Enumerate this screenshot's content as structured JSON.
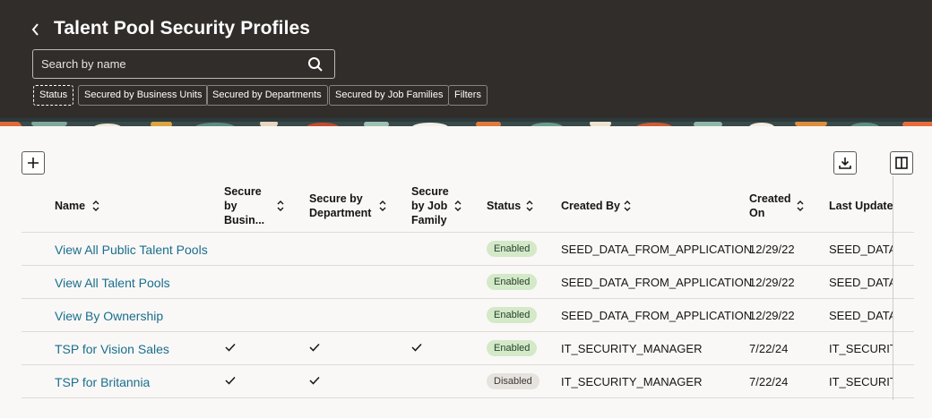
{
  "header": {
    "title": "Talent Pool Security Profiles",
    "search_placeholder": "Search by name",
    "filter_chips": [
      {
        "label": "Status"
      },
      {
        "label": "Secured by Business Units"
      },
      {
        "label": "Secured by Departments"
      },
      {
        "label": "Secured by Job Families"
      },
      {
        "label": "Filters"
      }
    ]
  },
  "icons": {
    "back": "chevron-left-icon",
    "search": "search-icon",
    "add": "plus-icon",
    "export": "download-icon",
    "columns": "columns-icon",
    "sort": "sort-icon",
    "check": "checkmark-icon"
  },
  "table": {
    "columns": [
      {
        "label": "Name"
      },
      {
        "label": "Secure by Busin..."
      },
      {
        "label": "Secure by Department"
      },
      {
        "label": "Secure by Job Family"
      },
      {
        "label": "Status"
      },
      {
        "label": "Created By"
      },
      {
        "label": "Created On"
      },
      {
        "label": "Last Updated"
      }
    ],
    "rows": [
      {
        "name": "View All Public Talent Pools",
        "busin": false,
        "dept": false,
        "job": false,
        "status": "Enabled",
        "created_by": "SEED_DATA_FROM_APPLICATION",
        "created_on": "12/29/22",
        "last_updated": "SEED_DATA_"
      },
      {
        "name": "View All Talent Pools",
        "busin": false,
        "dept": false,
        "job": false,
        "status": "Enabled",
        "created_by": "SEED_DATA_FROM_APPLICATION",
        "created_on": "12/29/22",
        "last_updated": "SEED_DATA_"
      },
      {
        "name": "View By Ownership",
        "busin": false,
        "dept": false,
        "job": false,
        "status": "Enabled",
        "created_by": "SEED_DATA_FROM_APPLICATION",
        "created_on": "12/29/22",
        "last_updated": "SEED_DATA_"
      },
      {
        "name": "TSP for Vision Sales",
        "busin": true,
        "dept": true,
        "job": true,
        "status": "Enabled",
        "created_by": "IT_SECURITY_MANAGER",
        "created_on": "7/22/24",
        "last_updated": "IT_SECURITY"
      },
      {
        "name": "TSP for Britannia",
        "busin": true,
        "dept": true,
        "job": false,
        "status": "Disabled",
        "created_by": "IT_SECURITY_MANAGER",
        "created_on": "7/22/24",
        "last_updated": "IT_SECURITY"
      }
    ]
  },
  "colors": {
    "header_bg": "#312d2a",
    "link": "#1a6e8e",
    "enabled_badge": "#d3e9c8",
    "disabled_badge": "#e6e3df"
  }
}
